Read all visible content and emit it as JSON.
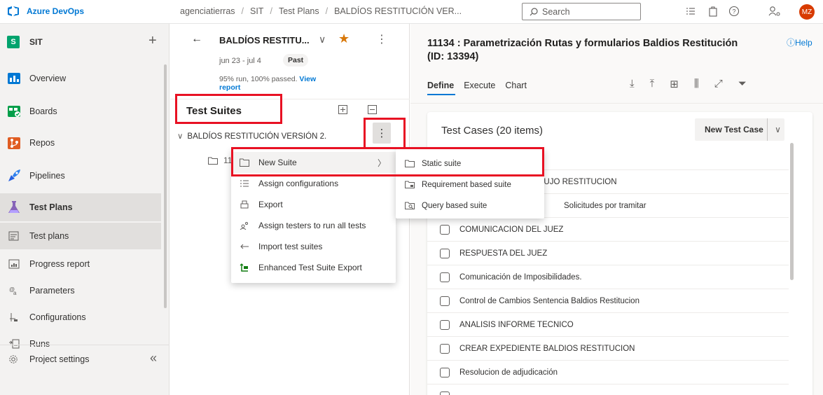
{
  "topbar": {
    "brand": "Azure DevOps",
    "breadcrumb": [
      "agenciatierras",
      "SIT",
      "Test Plans",
      "BALDÍOS RESTITUCIÓN VER..."
    ],
    "search_placeholder": "Search",
    "avatar_initials": "MZ",
    "icons": [
      "azure-devops-logo-icon",
      "search-icon",
      "task-list-icon",
      "marketplace-icon",
      "help-icon",
      "user-settings-icon"
    ]
  },
  "sidebar": {
    "project_badge": "S",
    "project_name": "SIT",
    "add_label": "+",
    "items": [
      {
        "label": "Overview",
        "icon": "overview-icon"
      },
      {
        "label": "Boards",
        "icon": "boards-icon"
      },
      {
        "label": "Repos",
        "icon": "repos-icon"
      },
      {
        "label": "Pipelines",
        "icon": "pipelines-icon"
      },
      {
        "label": "Test Plans",
        "icon": "test-plans-icon"
      }
    ],
    "subitems": [
      {
        "label": "Test plans",
        "icon": "test-plans-list-icon"
      },
      {
        "label": "Progress report",
        "icon": "progress-report-icon"
      },
      {
        "label": "Parameters",
        "icon": "parameters-icon"
      },
      {
        "label": "Configurations",
        "icon": "configurations-icon"
      },
      {
        "label": "Runs",
        "icon": "runs-icon"
      }
    ],
    "footer": {
      "label": "Project settings",
      "collapse": "«"
    }
  },
  "plan": {
    "title": "BALDÍOS RESTITU...",
    "dates": "jun 23 - jul 4",
    "badge": "Past",
    "stats": "95% run, 100% passed.",
    "stats_link": "View report"
  },
  "suites": {
    "title": "Test Suites",
    "root": "BALDÍOS RESTITUCIÓN VERSIÓN 2.",
    "child_prefix": "11"
  },
  "context_menu": {
    "items": [
      {
        "label": "New Suite",
        "icon": "new-suite-icon",
        "has_submenu": true
      },
      {
        "label": "Assign configurations",
        "icon": "assign-configurations-icon"
      },
      {
        "label": "Export",
        "icon": "export-icon"
      },
      {
        "label": "Assign testers to run all tests",
        "icon": "assign-testers-icon"
      },
      {
        "label": "Import test suites",
        "icon": "import-icon"
      },
      {
        "label": "Enhanced Test Suite Export",
        "icon": "enhanced-export-icon"
      }
    ],
    "submenu": [
      {
        "label": "Static suite",
        "icon": "static-suite-icon"
      },
      {
        "label": "Requirement based suite",
        "icon": "requirement-suite-icon"
      },
      {
        "label": "Query based suite",
        "icon": "query-suite-icon"
      }
    ]
  },
  "detail": {
    "title": "11134 : Parametrización Rutas y formularios Baldios Restitución (ID: 13394)",
    "help": "Help",
    "tabs": [
      "Define",
      "Execute",
      "Chart"
    ],
    "active_tab": "Define",
    "toolbar_icons": [
      "download-icon",
      "upload-icon",
      "grid-icon",
      "column-options-icon",
      "fullscreen-icon",
      "filter-icon"
    ],
    "card_title": "Test Cases (20 items)",
    "new_button": "New Test Case",
    "test_cases": [
      "LUJO RESTITUCION",
      "Solicitudes por tramitar",
      "COMUNICACION DEL JUEZ",
      "RESPUESTA DEL JUEZ",
      "Comunicación de Imposibilidades.",
      "Control de Cambios Sentencia Baldios Restitucion",
      "ANALISIS INFORME TECNICO",
      "CREAR EXPEDIENTE BALDIOS RESTITUCION",
      "Resolucion de adjudicación"
    ]
  },
  "colors": {
    "accent": "#0078d4",
    "highlight": "#e81123",
    "star": "#d8780a"
  }
}
